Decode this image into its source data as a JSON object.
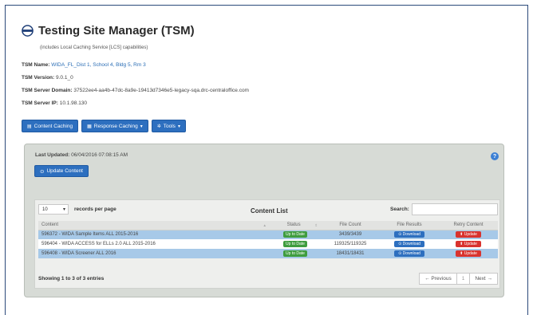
{
  "header": {
    "title": "Testing Site Manager (TSM)",
    "subtitle": "(includes Local Caching Service [LCS] capabilities)"
  },
  "info": {
    "name_label": "TSM Name:",
    "name_value": "WIDA_FL_Dist 1, School 4, Bldg 5, Rm 3",
    "version_label": "TSM Version:",
    "version_value": "9.0.1_0",
    "domain_label": "TSM Server Domain:",
    "domain_value": "37522ee4-aa4b-47dc-8a9e-19413d7346e5-legacy-sqa.drc-centraloffice.com",
    "ip_label": "TSM Server IP:",
    "ip_value": "10.1.98.130"
  },
  "toolbar": {
    "content_caching": "Content Caching",
    "response_caching": "Response Caching",
    "tools": "Tools"
  },
  "panel": {
    "last_updated_label": "Last Updated:",
    "last_updated_value": "06/04/2016 07:08:15 AM",
    "update_button": "Update Content",
    "help": "?"
  },
  "content_list": {
    "length_value": "10",
    "length_label": "records per page",
    "title": "Content List",
    "search_label": "Search:",
    "search_value": "",
    "columns": [
      "Content",
      "Status",
      "File Count",
      "File Results",
      "Retry Content"
    ],
    "rows": [
      {
        "content": "596372 - WIDA Sample Items ALL 2015-2016",
        "status": "Up to Date",
        "file_count": "3439/3439",
        "download": "Download",
        "update": "Update"
      },
      {
        "content": "596404 - WIDA ACCESS for ELLs 2.0 ALL 2015-2016",
        "status": "Up to Date",
        "file_count": "119325/119325",
        "download": "Download",
        "update": "Update"
      },
      {
        "content": "596408 - WIDA Screener ALL 2016",
        "status": "Up to Date",
        "file_count": "18431/18431",
        "download": "Download",
        "update": "Update"
      }
    ],
    "showing": "Showing 1 to 3 of 3 entries",
    "previous": "← Previous",
    "page": "1",
    "next": "Next →"
  }
}
